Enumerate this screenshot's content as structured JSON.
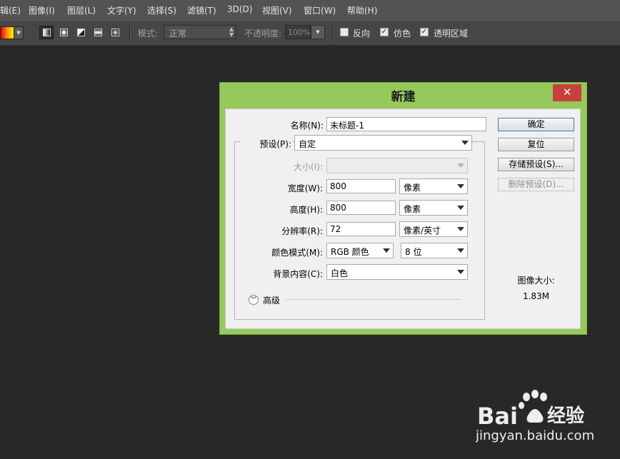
{
  "menubar": {
    "items": [
      "辑(E)",
      "图像(I)",
      "图层(L)",
      "文字(Y)",
      "选择(S)",
      "滤镜(T)",
      "3D(D)",
      "视图(V)",
      "窗口(W)",
      "帮助(H)"
    ]
  },
  "options": {
    "mode_label": "模式:",
    "mode_value": "正常",
    "opacity_label": "不透明度:",
    "opacity_value": "100%",
    "reverse_label": "反向",
    "dither_label": "仿色",
    "transparency_label": "透明区域",
    "reverse_checked": false,
    "dither_checked": true,
    "transparency_checked": true
  },
  "dialog": {
    "title": "新建",
    "close_glyph": "✕",
    "name_label": "名称(N):",
    "name_value": "未标题-1",
    "preset_label": "预设(P):",
    "preset_value": "自定",
    "size_label": "大小(I):",
    "size_value": "",
    "width_label": "宽度(W):",
    "width_value": "800",
    "width_unit": "像素",
    "height_label": "高度(H):",
    "height_value": "800",
    "height_unit": "像素",
    "resolution_label": "分辨率(R):",
    "resolution_value": "72",
    "resolution_unit": "像素/英寸",
    "color_mode_label": "颜色模式(M):",
    "color_mode_value": "RGB 颜色",
    "bit_depth_value": "8 位",
    "background_label": "背景内容(C):",
    "background_value": "白色",
    "advanced_label": "高级",
    "buttons": {
      "ok": "确定",
      "reset": "复位",
      "save_preset": "存储预设(S)...",
      "delete_preset": "删除预设(D)..."
    },
    "image_size_label": "图像大小:",
    "image_size_value": "1.83M"
  },
  "watermark": {
    "brand_left": "Bai",
    "brand_right": "经验",
    "url": "jingyan.baidu.com"
  },
  "colors": {
    "dialog_frame": "#96c95c",
    "close_button": "#c7403c",
    "canvas": "#282828",
    "menubar": "#535353",
    "options_bar": "#464646"
  }
}
